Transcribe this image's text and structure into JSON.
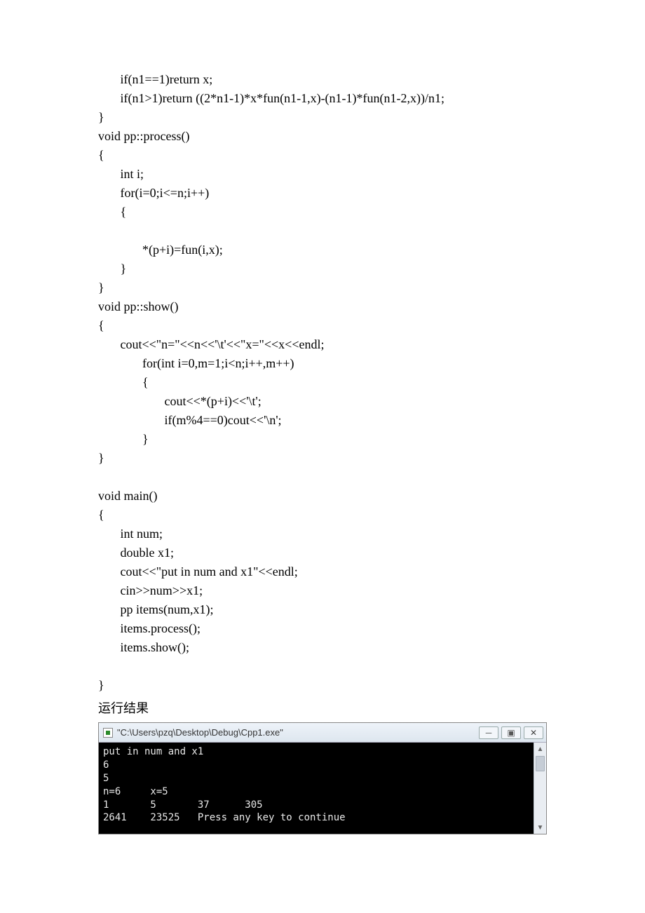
{
  "code": "       if(n1==1)return x;\n       if(n1>1)return ((2*n1-1)*x*fun(n1-1,x)-(n1-1)*fun(n1-2,x))/n1;\n}\nvoid pp::process()\n{\n       int i;\n       for(i=0;i<=n;i++)\n       {\n\n              *(p+i)=fun(i,x);\n       }\n}\nvoid pp::show()\n{\n       cout<<\"n=\"<<n<<'\\t'<<\"x=\"<<x<<endl;\n              for(int i=0,m=1;i<n;i++,m++)\n              {\n                     cout<<*(p+i)<<'\\t';\n                     if(m%4==0)cout<<'\\n';\n              }\n}\n\nvoid main()\n{\n       int num;\n       double x1;\n       cout<<\"put in num and x1\"<<endl;\n       cin>>num>>x1;\n       pp items(num,x1);\n       items.process();\n       items.show();\n\n}",
  "resultLabel": "运行结果",
  "window": {
    "title": "\"C:\\Users\\pzq\\Desktop\\Debug\\Cpp1.exe\"",
    "minimize": "─",
    "maximize": "▣",
    "close": "✕"
  },
  "console": "put in num and x1\n6\n5\nn=6     x=5\n1       5       37      305\n2641    23525   Press any key to continue"
}
